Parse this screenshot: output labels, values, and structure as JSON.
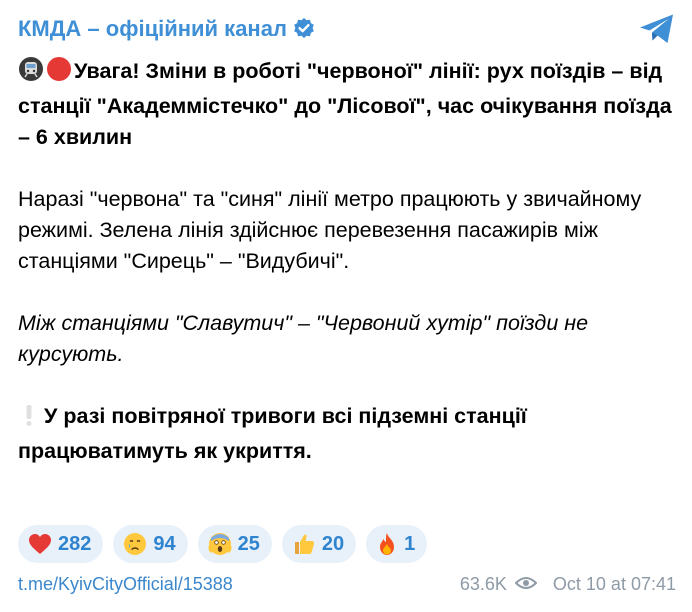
{
  "channel": {
    "name": "КМДА – офіційний канал",
    "verified_icon": "verified-badge-icon",
    "logo_icon": "telegram-logo-icon"
  },
  "post": {
    "headline": "Увага! Зміни в роботі \"червоної\" лінії: рух поїздів – від станції \"Академмістечко\" до \"Лісової\", час очікування поїзда – 6 хвилин",
    "paragraph_1": "Наразі \"червона\" та \"синя\" лінії метро працюють у звичайному режимі. Зелена лінія здійснює перевезення пасажирів між станціями \"Сирець\" – \"Видубичі\".",
    "paragraph_2": "Між станціями \"Славутич\" – \"Червоний хутір\" поїзди не курсують.",
    "paragraph_3": "У разі повітряної тривоги всі підземні станції працюватимуть як укриття."
  },
  "reactions": [
    {
      "icon": "heart-icon",
      "count": "282"
    },
    {
      "icon": "crying-face-icon",
      "count": "94"
    },
    {
      "icon": "screaming-face-icon",
      "count": "25"
    },
    {
      "icon": "thumbs-up-icon",
      "count": "20"
    },
    {
      "icon": "fire-icon",
      "count": "1"
    }
  ],
  "footer": {
    "link": "t.me/KyivCityOfficial/15388",
    "views": "63.6K",
    "views_icon": "eye-icon",
    "date": "Oct 10 at 07:41"
  },
  "colors": {
    "accent": "#3f8fd6",
    "reaction_bg": "#e8f1fa",
    "reaction_text": "#2f84d0",
    "muted": "#8e9aa6"
  }
}
